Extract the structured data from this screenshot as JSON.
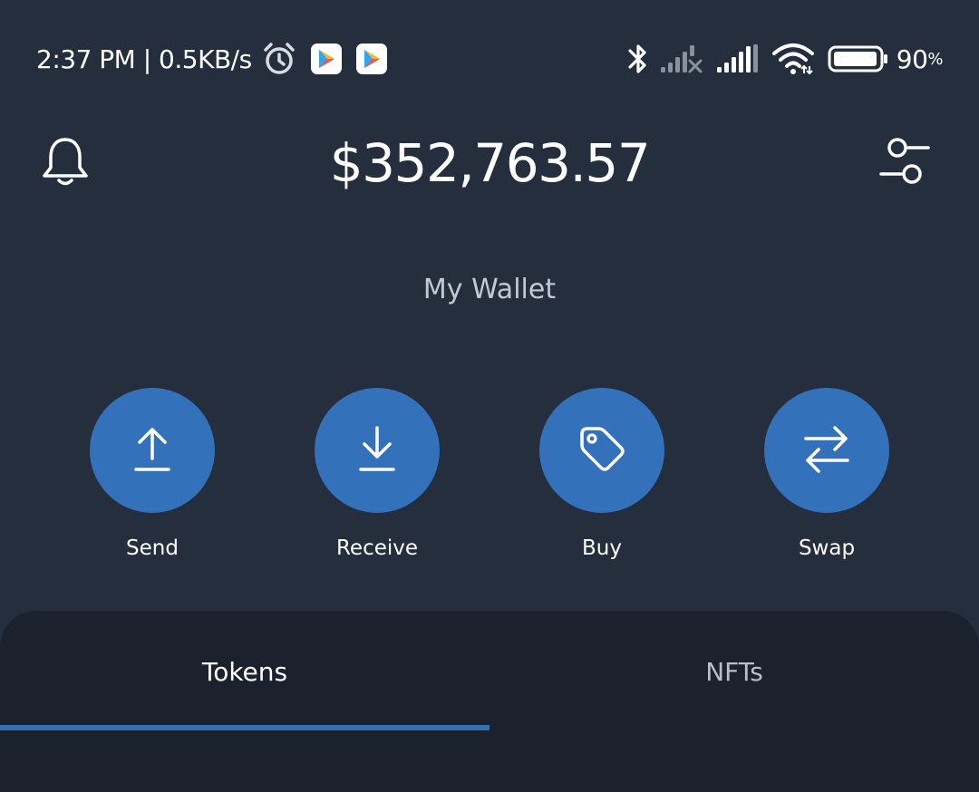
{
  "status_bar": {
    "time_speed": "2:37 PM | 0.5KB/s",
    "battery_value": "90",
    "battery_unit": "%",
    "icons": [
      "alarm-icon",
      "play-app-icon",
      "play-app-icon",
      "bluetooth-icon",
      "signal-off-icon",
      "signal-icon",
      "wifi-icon",
      "battery-icon"
    ]
  },
  "header": {
    "balance": "$352,763.57",
    "wallet_name": "My Wallet",
    "left_icon": "bell-icon",
    "right_icon": "filter-icon"
  },
  "actions": [
    {
      "label": "Send",
      "icon": "upload-arrow-icon"
    },
    {
      "label": "Receive",
      "icon": "download-arrow-icon"
    },
    {
      "label": "Buy",
      "icon": "tag-icon"
    },
    {
      "label": "Swap",
      "icon": "swap-arrows-icon"
    }
  ],
  "tabs": [
    {
      "label": "Tokens",
      "active": true
    },
    {
      "label": "NFTs",
      "active": false
    }
  ],
  "colors": {
    "background": "#242e3c",
    "panel": "#1c222d",
    "accent": "#3471bb",
    "muted_text": "#c3c9d3"
  }
}
